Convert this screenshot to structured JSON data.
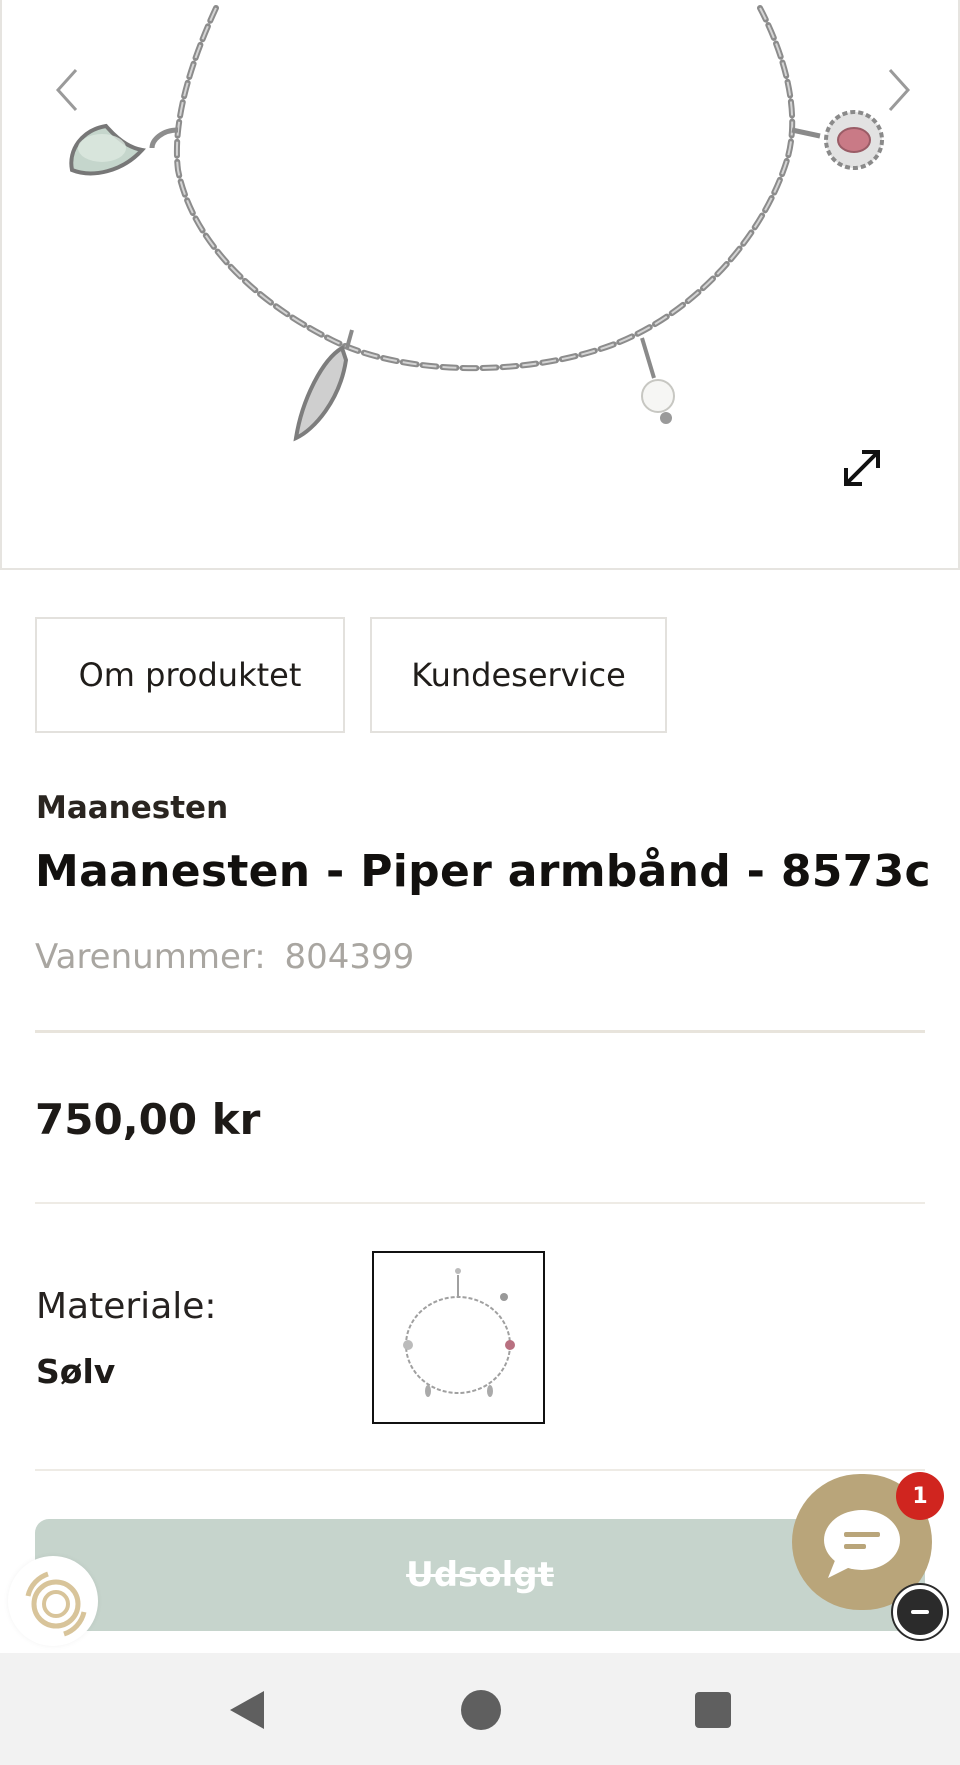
{
  "gallery": {
    "image_alt": "Maanesten - Piper armbånd - 8573c",
    "prev_icon": "chevron-left-icon",
    "next_icon": "chevron-right-icon",
    "expand_icon": "expand-icon"
  },
  "tabs": {
    "about_label": "Om produktet",
    "service_label": "Kundeservice"
  },
  "product": {
    "brand": "Maanesten",
    "title": "Maanesten - Piper armbånd - 8573c",
    "sku_label": "Varenummer:",
    "sku_value": "804399",
    "price": "750,00 kr"
  },
  "material": {
    "label": "Materiale:",
    "value": "Sølv"
  },
  "cart": {
    "soldout_label": "Udsolgt",
    "button_color": "#c6d4cc"
  },
  "chat": {
    "badge_count": "1",
    "bubble_color": "#b9a57a",
    "badge_color": "#d0251f"
  },
  "system_nav": {
    "back_icon": "back-triangle-icon",
    "home_icon": "home-circle-icon",
    "recents_icon": "recents-square-icon"
  }
}
